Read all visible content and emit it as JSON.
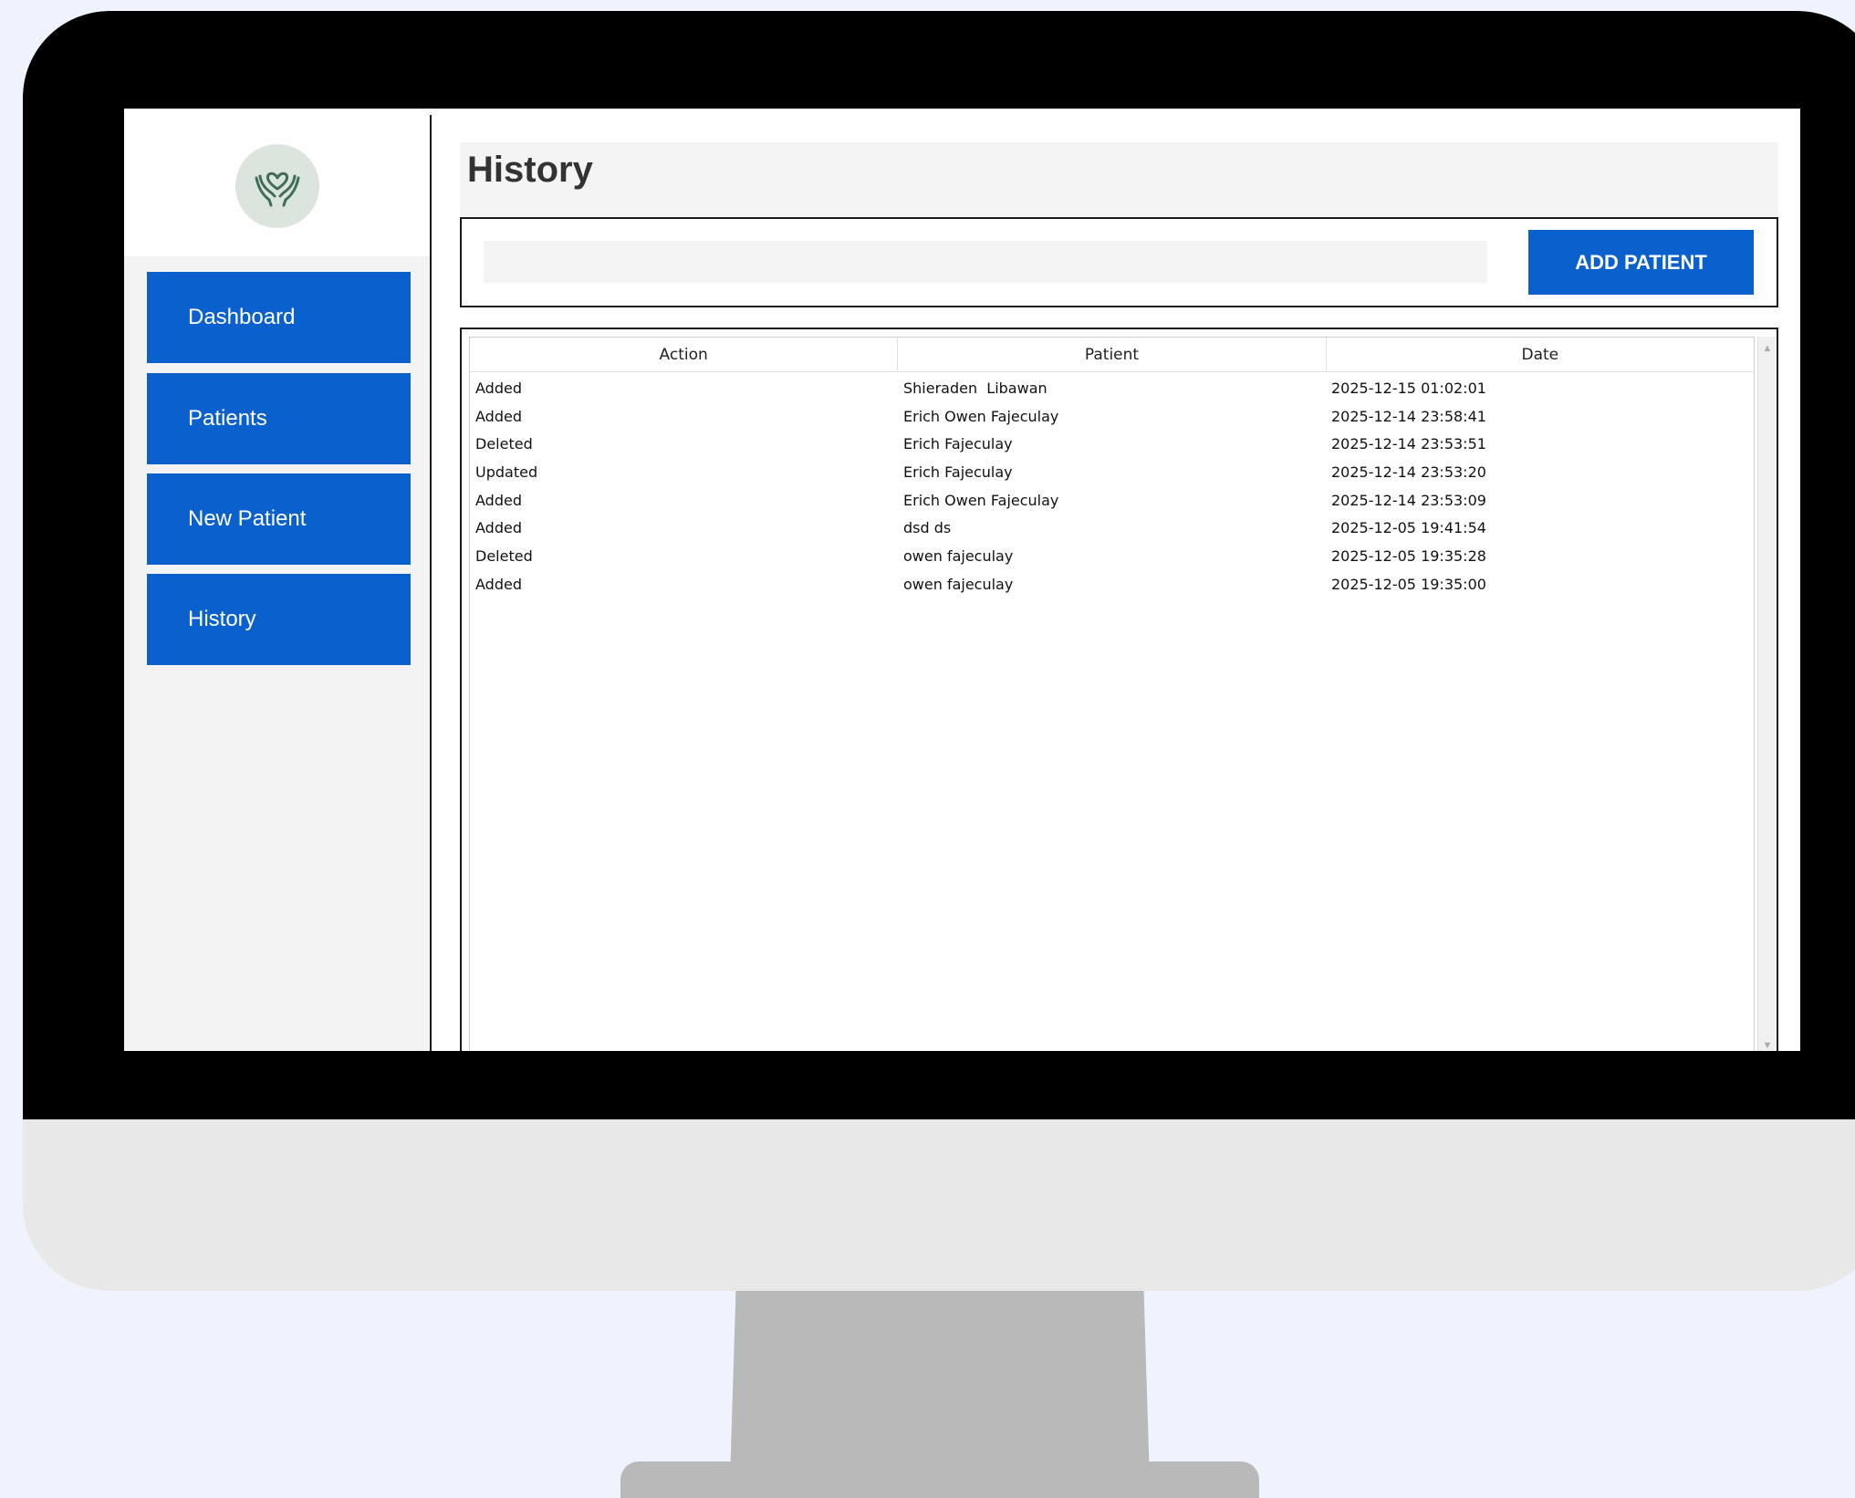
{
  "sidebar": {
    "logo_icon": "hands-heart-icon",
    "items": [
      {
        "label": "Dashboard"
      },
      {
        "label": "Patients"
      },
      {
        "label": "New Patient"
      },
      {
        "label": "History"
      }
    ]
  },
  "header": {
    "title": "History"
  },
  "toolbar": {
    "search_value": "",
    "add_label": "ADD PATIENT"
  },
  "table": {
    "columns": [
      "Action",
      "Patient",
      "Date"
    ],
    "rows": [
      [
        "Added",
        "Shieraden  Libawan",
        "2025-12-15 01:02:01"
      ],
      [
        "Added",
        "Erich Owen Fajeculay",
        "2025-12-14 23:58:41"
      ],
      [
        "Deleted",
        "Erich Fajeculay",
        "2025-12-14 23:53:51"
      ],
      [
        "Updated",
        "Erich Fajeculay",
        "2025-12-14 23:53:20"
      ],
      [
        "Added",
        "Erich Owen Fajeculay",
        "2025-12-14 23:53:09"
      ],
      [
        "Added",
        "dsd ds",
        "2025-12-05 19:41:54"
      ],
      [
        "Deleted",
        "owen fajeculay",
        "2025-12-05 19:35:28"
      ],
      [
        "Added",
        "owen fajeculay",
        "2025-12-05 19:35:00"
      ]
    ]
  },
  "colors": {
    "accent": "#0a60cc",
    "logo_bg": "#dbe5de",
    "logo_stroke": "#3e6e56"
  }
}
